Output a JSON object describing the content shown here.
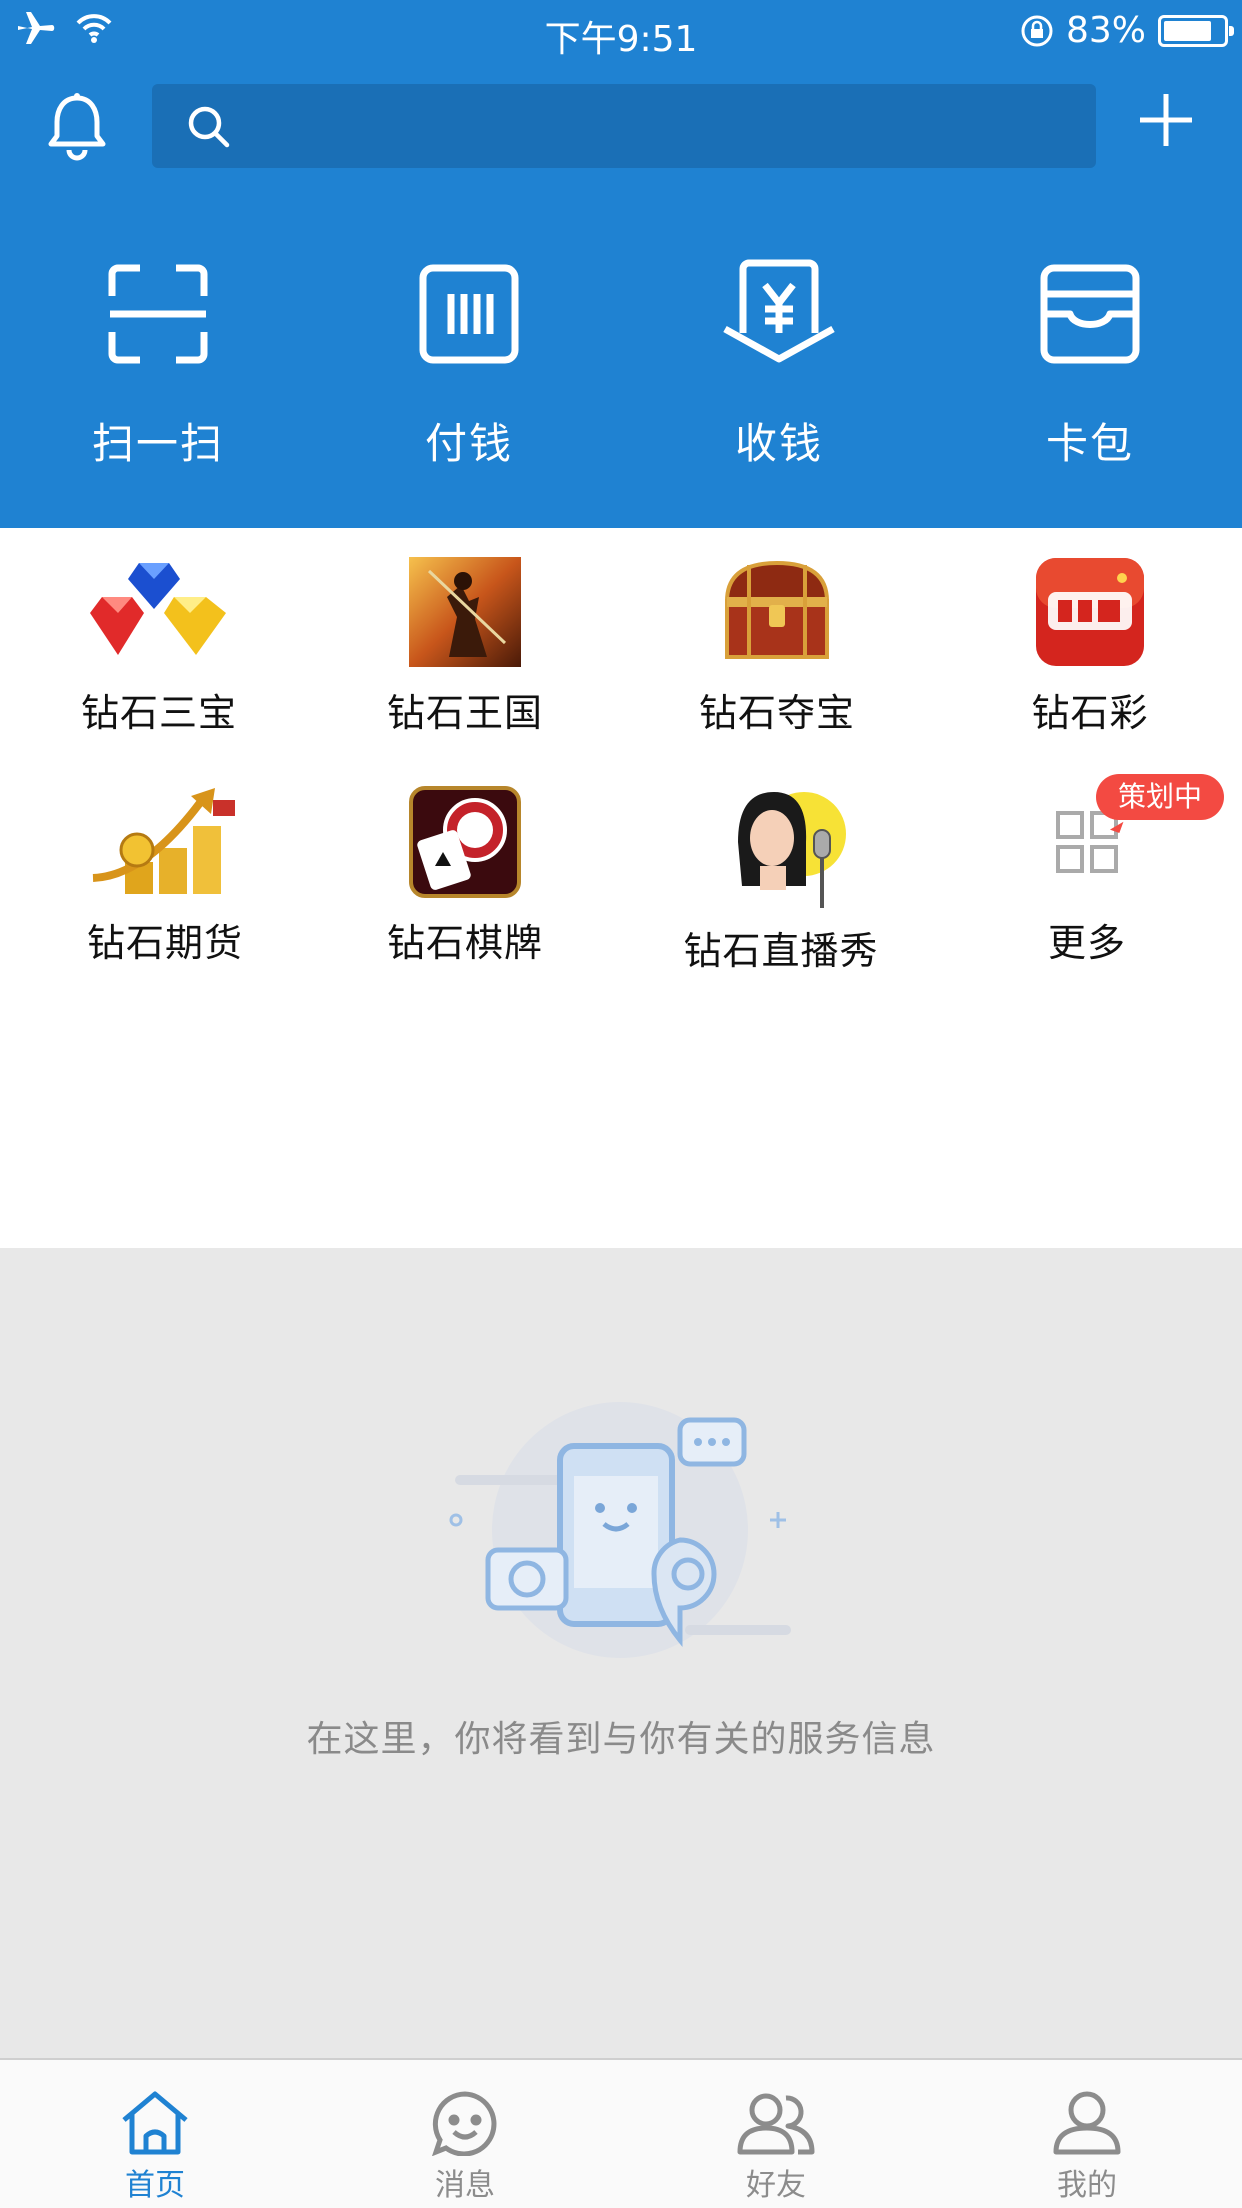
{
  "status": {
    "time": "下午9:51",
    "battery": "83%",
    "battery_level": 0.83
  },
  "search": {
    "placeholder": ""
  },
  "quick_actions": [
    {
      "label": "扫一扫",
      "icon": "scan-icon"
    },
    {
      "label": "付钱",
      "icon": "pay-icon"
    },
    {
      "label": "收钱",
      "icon": "receive-money-icon"
    },
    {
      "label": "卡包",
      "icon": "wallet-icon"
    }
  ],
  "apps": [
    {
      "label": "钻石三宝",
      "icon": "diamonds-icon"
    },
    {
      "label": "钻石王国",
      "icon": "warrior-icon"
    },
    {
      "label": "钻石夺宝",
      "icon": "treasure-chest-icon"
    },
    {
      "label": "钻石彩",
      "icon": "lottery-icon"
    },
    {
      "label": "钻石期货",
      "icon": "gold-coins-icon"
    },
    {
      "label": "钻石棋牌",
      "icon": "poker-chip-icon"
    },
    {
      "label": "钻石直播秀",
      "icon": "live-singer-icon"
    },
    {
      "label": "更多",
      "icon": "grid-icon"
    }
  ],
  "more_badge": "策划中",
  "empty_state": {
    "text": "在这里，你将看到与你有关的服务信息"
  },
  "tabs": [
    {
      "label": "首页",
      "icon": "home-icon",
      "active": true
    },
    {
      "label": "消息",
      "icon": "chat-icon",
      "active": false
    },
    {
      "label": "好友",
      "icon": "friends-icon",
      "active": false
    },
    {
      "label": "我的",
      "icon": "profile-icon",
      "active": false
    }
  ],
  "colors": {
    "primary": "#1f82d2",
    "badge": "#f34a42",
    "background": "#e8e8e8"
  }
}
